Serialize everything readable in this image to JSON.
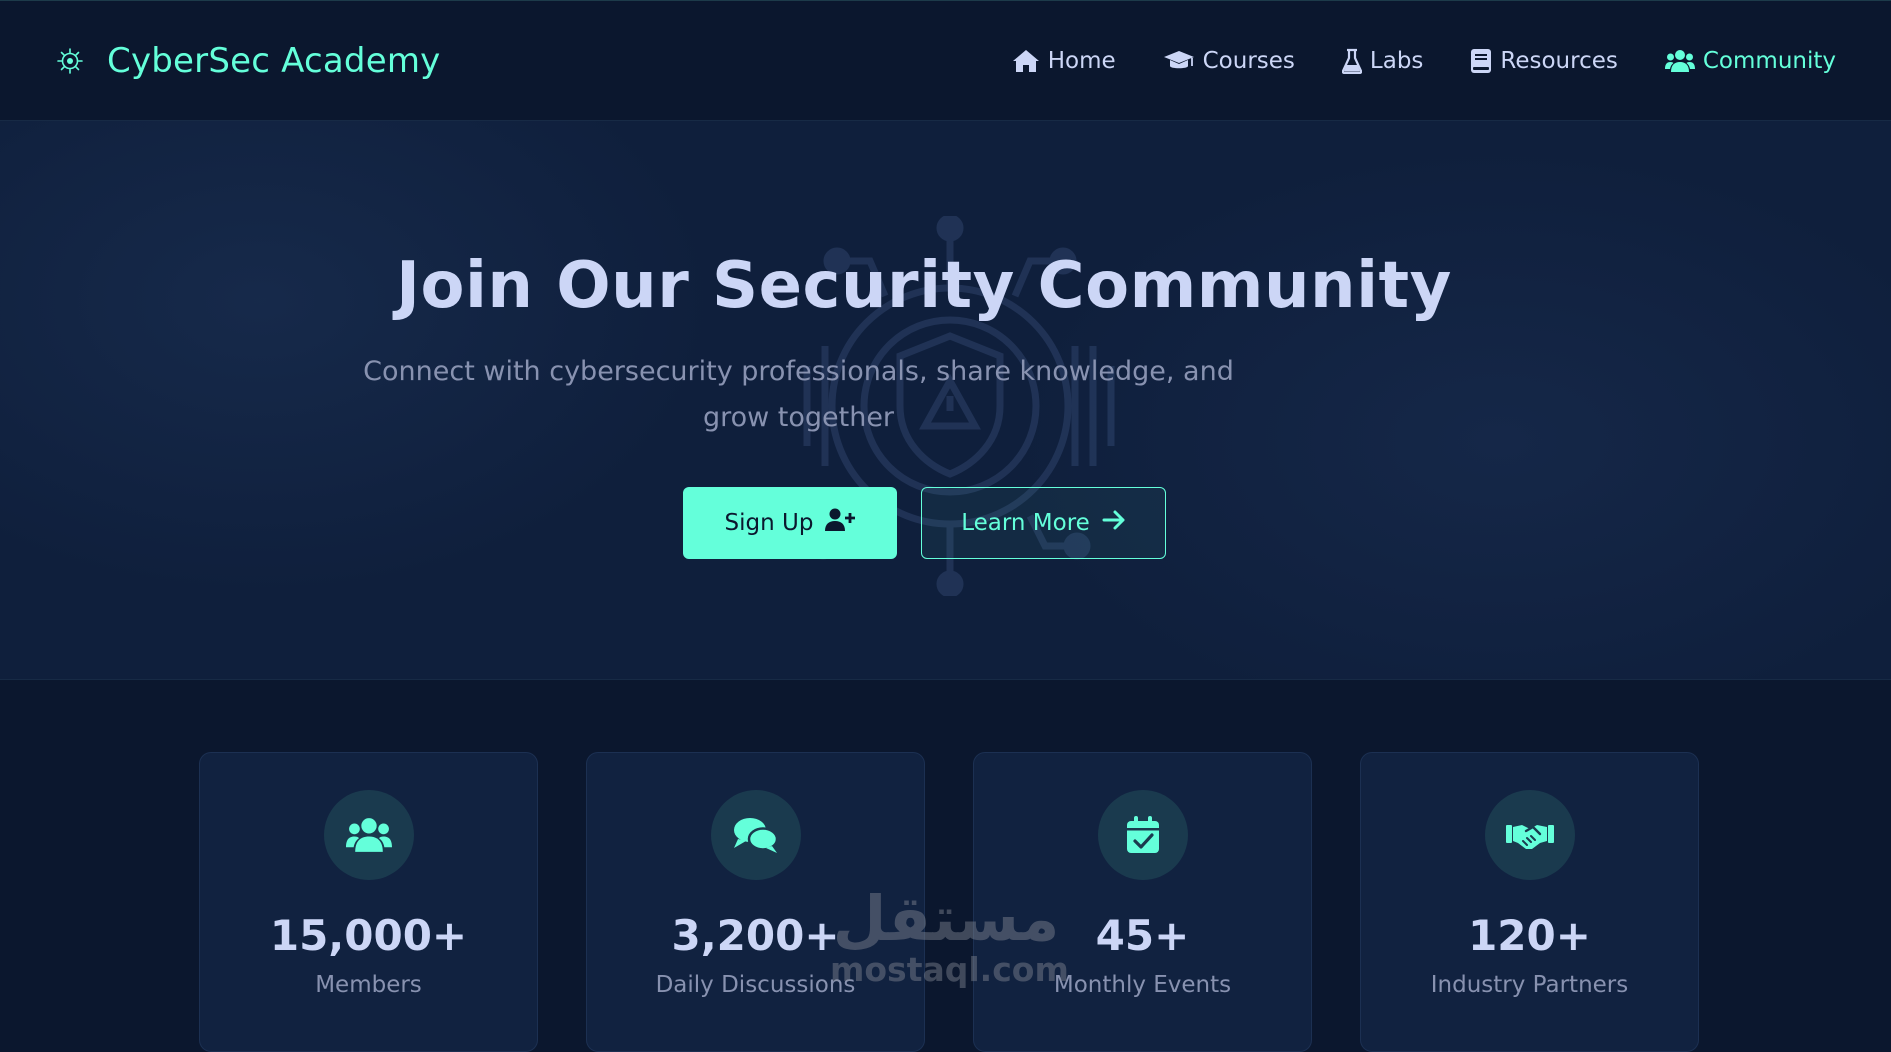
{
  "brand": {
    "name": "CyberSec Academy",
    "logo_icon": "virus-shield-icon"
  },
  "nav": {
    "items": [
      {
        "label": "Home",
        "icon": "home-icon",
        "active": false
      },
      {
        "label": "Courses",
        "icon": "graduation-cap-icon",
        "active": false
      },
      {
        "label": "Labs",
        "icon": "flask-icon",
        "active": false
      },
      {
        "label": "Resources",
        "icon": "book-icon",
        "active": false
      },
      {
        "label": "Community",
        "icon": "users-icon",
        "active": true
      }
    ]
  },
  "hero": {
    "title": "Join Our Security Community",
    "subtitle": "Connect with cybersecurity professionals, share knowledge, and grow together",
    "signup_label": "Sign Up",
    "signup_icon": "user-plus-icon",
    "learn_more_label": "Learn More",
    "learn_more_icon": "arrow-right-icon",
    "background_icon": "shield-warning-circuit-icon"
  },
  "stats": [
    {
      "value": "15,000+",
      "label": "Members",
      "icon": "users-icon"
    },
    {
      "value": "3,200+",
      "label": "Daily Discussions",
      "icon": "comments-icon"
    },
    {
      "value": "45+",
      "label": "Monthly Events",
      "icon": "calendar-check-icon"
    },
    {
      "value": "120+",
      "label": "Industry Partners",
      "icon": "handshake-icon"
    }
  ],
  "watermark": {
    "arabic": "مستقل",
    "latin": "mostaql.com"
  },
  "colors": {
    "accent": "#64ffda",
    "background": "#0b172e",
    "hero_background": "#0f1f3c",
    "card_background": "#112240",
    "text_primary": "#ccd6f6",
    "text_secondary": "#8892b0"
  }
}
